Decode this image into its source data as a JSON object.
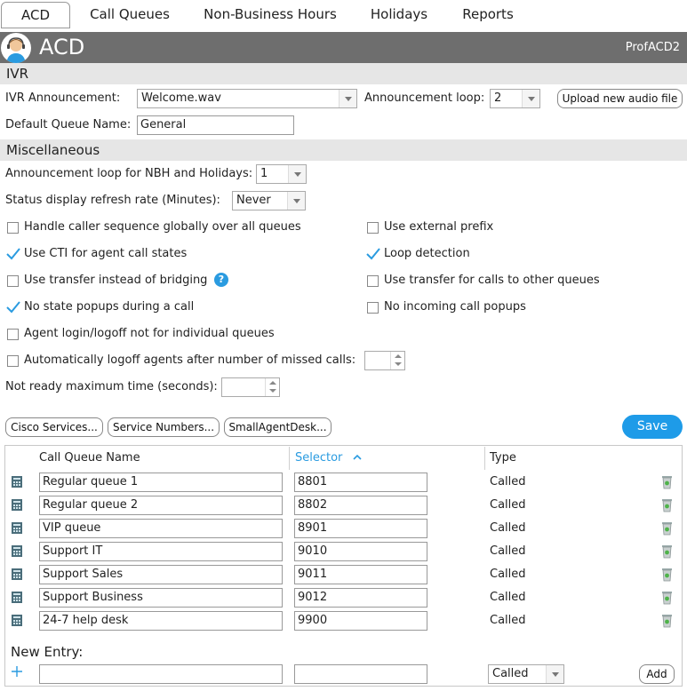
{
  "tabs": [
    {
      "label": "ACD",
      "active": true
    },
    {
      "label": "Call Queues"
    },
    {
      "label": "Non-Business Hours"
    },
    {
      "label": "Holidays"
    },
    {
      "label": "Reports"
    }
  ],
  "header": {
    "title": "ACD",
    "profile": "ProfACD2"
  },
  "ivr": {
    "section_title": "IVR",
    "announcement_label": "IVR Announcement:",
    "announcement_value": "Welcome.wav",
    "loop_label": "Announcement loop:",
    "loop_value": "2",
    "upload_button": "Upload new audio file",
    "default_queue_label": "Default Queue Name:",
    "default_queue_value": "General"
  },
  "misc": {
    "section_title": "Miscellaneous",
    "nbh_loop_label": "Announcement loop for NBH and Holidays:",
    "nbh_loop_value": "1",
    "refresh_label": "Status display refresh rate (Minutes):",
    "refresh_value": "Never",
    "options": {
      "handle_sequence": {
        "label": "Handle caller sequence globally over all queues",
        "checked": false
      },
      "external_prefix": {
        "label": "Use external prefix",
        "checked": false
      },
      "use_cti": {
        "label": "Use CTI for agent call states",
        "checked": true
      },
      "loop_detection": {
        "label": "Loop detection",
        "checked": true
      },
      "transfer_bridging": {
        "label": "Use transfer instead of bridging",
        "checked": false
      },
      "transfer_other": {
        "label": "Use transfer for calls to other queues",
        "checked": false
      },
      "no_state_popups": {
        "label": "No state popups during a call",
        "checked": true
      },
      "no_incoming_popups": {
        "label": "No incoming call popups",
        "checked": false
      },
      "agent_login": {
        "label": "Agent login/logoff not for individual queues",
        "checked": false
      },
      "auto_logoff": {
        "label": "Automatically logoff agents after number of missed calls:",
        "checked": false
      }
    },
    "not_ready_label": "Not ready maximum time (seconds):"
  },
  "buttons": {
    "cisco": "Cisco Services...",
    "service_numbers": "Service Numbers...",
    "small_agent": "SmallAgentDesk...",
    "save": "Save",
    "add": "Add"
  },
  "table": {
    "headers": {
      "name": "Call Queue Name",
      "selector": "Selector",
      "type": "Type"
    },
    "rows": [
      {
        "name": "Regular queue 1",
        "selector": "8801",
        "type": "Called"
      },
      {
        "name": "Regular queue 2",
        "selector": "8802",
        "type": "Called"
      },
      {
        "name": "VIP queue",
        "selector": "8901",
        "type": "Called"
      },
      {
        "name": "Support IT",
        "selector": "9010",
        "type": "Called"
      },
      {
        "name": "Support Sales",
        "selector": "9011",
        "type": "Called"
      },
      {
        "name": "Support Business",
        "selector": "9012",
        "type": "Called"
      },
      {
        "name": "24-7 help desk",
        "selector": "9900",
        "type": "Called"
      }
    ],
    "new_entry_label": "New Entry:",
    "new_entry_type": "Called"
  },
  "colors": {
    "accent": "#1e9be8",
    "header_bg": "#6e6e6e",
    "section_bg": "#e6e6e6"
  }
}
